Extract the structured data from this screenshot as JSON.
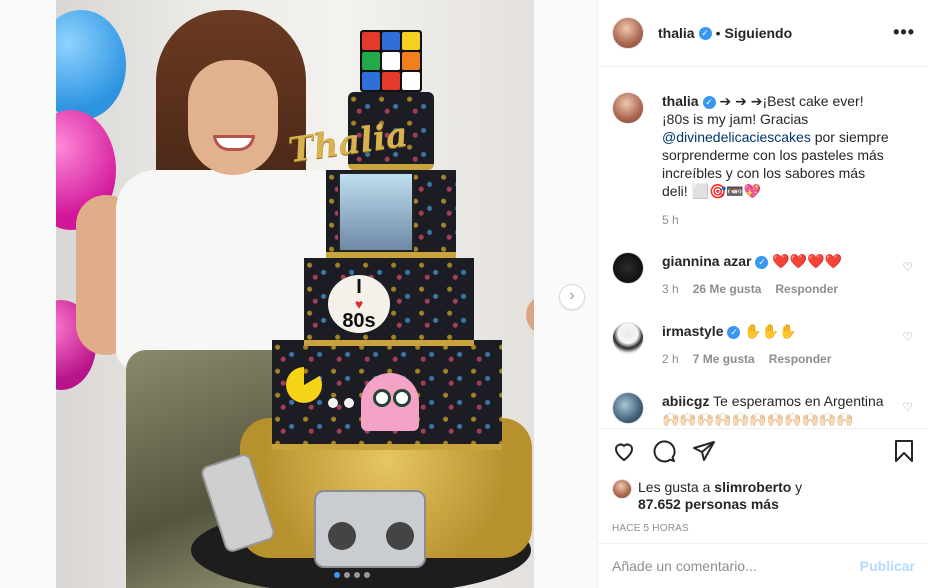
{
  "post": {
    "username": "thalia",
    "separator": "•",
    "following_label": "Siguiendo",
    "more_label": "•••",
    "verified_mark": "✓"
  },
  "caption": {
    "username": "thalia",
    "text_before": " ➔ ➔ ➔¡Best cake ever! ¡80s is my jam! Gracias ",
    "mention": "@divinedelicaciescakes",
    "text_after": " por siempre sorprenderme con los pasteles más increíbles y con los sabores más deli! ⬜🎯📼💖",
    "time": "5 h"
  },
  "comments": [
    {
      "username": "giannina azar",
      "text": "❤️❤️❤️❤️",
      "time": "3 h",
      "likes": "26 Me gusta",
      "reply": "Responder"
    },
    {
      "username": "irmastyle",
      "text": "✋✋✋",
      "time": "2 h",
      "likes": "7 Me gusta",
      "reply": "Responder"
    },
    {
      "username": "abiicgz",
      "text": "Te esperamos en Argentina🙌🏻🙌🏻🙌🏻🙌🏻🙌🏻🙌🏻🙌🏻🙌🏻🙌🏻🙌🏻🙌🏻",
      "time": "",
      "likes": "",
      "reply": ""
    }
  ],
  "likes": {
    "prefix": "Les gusta a ",
    "user": "slimroberto",
    "middle": " y ",
    "others": "87.652 personas más"
  },
  "timestamp": "HACE 5 HORAS",
  "comment_box": {
    "placeholder": "Añade un comentario...",
    "publish_label": "Publicar"
  },
  "image": {
    "topper_text": "Thalia",
    "i80_top": "I",
    "i80_heart": "♥",
    "i80_bottom": "80s",
    "next_arrow": "›",
    "rubik_colors": [
      "#e23b2e",
      "#2e6fd9",
      "#f5d020",
      "#23a94a",
      "#ffffff",
      "#f07f1e",
      "#2e6fd9",
      "#e23b2e",
      "#ffffff"
    ]
  },
  "icons": {
    "heart": "heart-icon",
    "comment": "comment-icon",
    "share": "share-icon",
    "save": "bookmark-icon"
  },
  "colors": {
    "accent": "#3897f0",
    "publish": "#b3dbff"
  }
}
